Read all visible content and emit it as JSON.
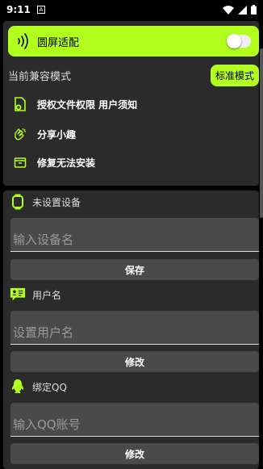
{
  "status_bar": {
    "time": "9:11",
    "notification_glyph": "A"
  },
  "round_screen": {
    "label": "圆屏适配",
    "enabled": false
  },
  "compat": {
    "label": "当前兼容模式",
    "mode_button": "标准模式"
  },
  "menu": [
    {
      "label": "授权文件权限 用户须知",
      "icon": "file-plus-icon"
    },
    {
      "label": "分享小趣",
      "icon": "hands-icon"
    },
    {
      "label": "修复无法安装",
      "icon": "archive-icon"
    }
  ],
  "device": {
    "title": "未设置设备",
    "placeholder": "输入设备名",
    "value": "",
    "button": "保存"
  },
  "username": {
    "title": "用户名",
    "placeholder": "设置用户名",
    "value": "",
    "button": "修改"
  },
  "qq": {
    "title": "绑定QQ",
    "placeholder": "输入QQ账号",
    "value": "",
    "button": "修改"
  },
  "colors": {
    "accent": "#b2ff1f",
    "card": "#2b2b2b",
    "input": "#4a4a4a",
    "background": "#000000"
  }
}
